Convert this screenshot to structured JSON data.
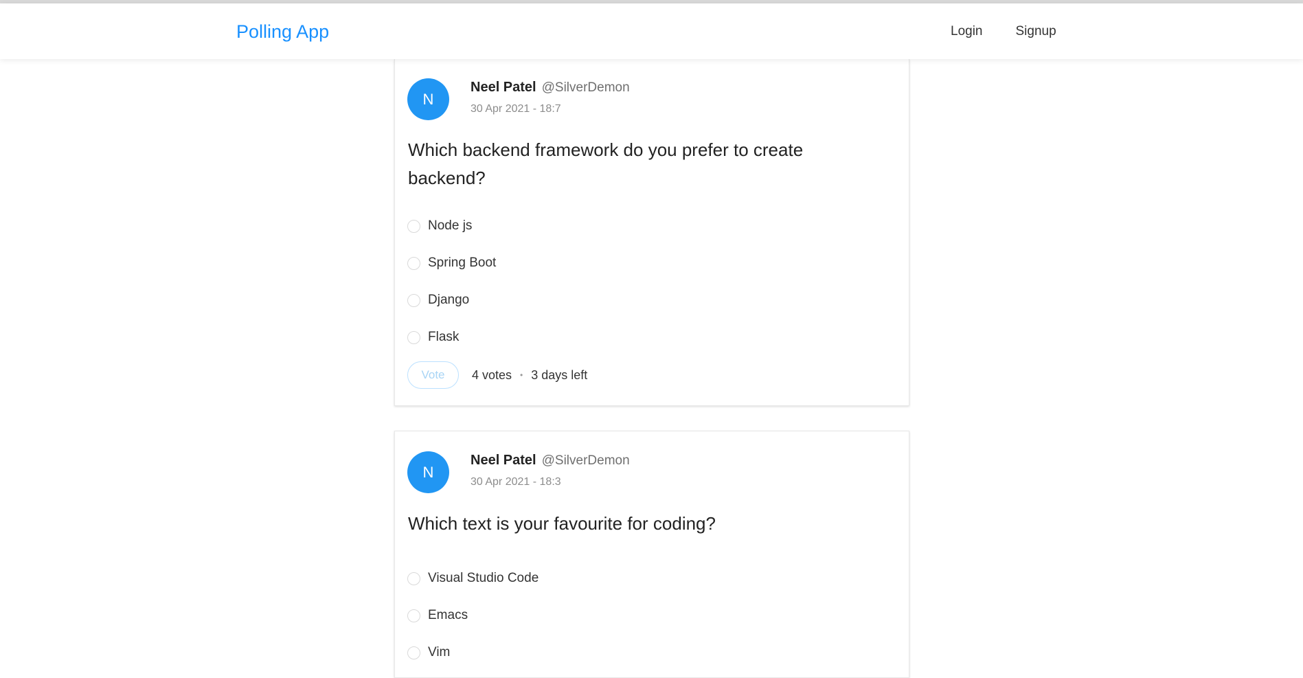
{
  "header": {
    "brand": "Polling App",
    "nav": [
      {
        "label": "Login"
      },
      {
        "label": "Signup"
      }
    ]
  },
  "polls": [
    {
      "avatar_letter": "N",
      "full_name": "Neel Patel",
      "username": "@SilverDemon",
      "created_at": "30 Apr 2021 - 18:7",
      "question": "Which backend framework do you prefer to create backend?",
      "choices": [
        {
          "label": "Node js"
        },
        {
          "label": "Spring Boot"
        },
        {
          "label": "Django"
        },
        {
          "label": "Flask"
        }
      ],
      "vote_label": "Vote",
      "votes": "4 votes",
      "separator": "•",
      "time_left": "3 days left"
    },
    {
      "avatar_letter": "N",
      "full_name": "Neel Patel",
      "username": "@SilverDemon",
      "created_at": "30 Apr 2021 - 18:3",
      "question": "Which text is your favourite for coding?",
      "choices": [
        {
          "label": "Visual Studio Code"
        },
        {
          "label": "Emacs"
        },
        {
          "label": "Vim"
        }
      ]
    }
  ],
  "colors": {
    "brand": "#1890ff",
    "avatar": "#2196f3",
    "vote_border": "#bae0ff"
  }
}
